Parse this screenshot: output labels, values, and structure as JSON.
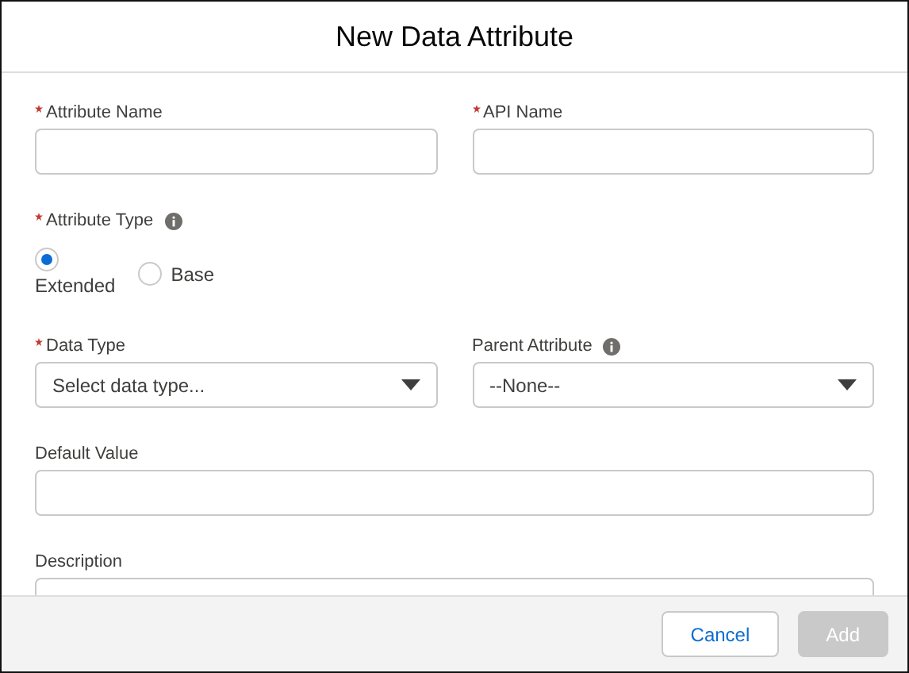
{
  "window": {
    "title": "New Data Attribute"
  },
  "rows": [
    {
      "fields": [
        {
          "kind": "text",
          "label": "Attribute Name",
          "required": true,
          "info": false
        },
        {
          "kind": "text",
          "label": "API Name",
          "required": true,
          "info": false
        }
      ]
    },
    {
      "fields": [
        {
          "kind": "radio",
          "label": "Attribute Type",
          "required": true,
          "info": true,
          "options": [
            {
              "label": "Extended",
              "selected": true
            },
            {
              "label": "Base",
              "selected": false
            }
          ]
        }
      ]
    },
    {
      "fields": [
        {
          "kind": "select",
          "label": "Data Type",
          "required": true,
          "info": false,
          "value": "Select data type..."
        },
        {
          "kind": "select",
          "label": "Parent Attribute",
          "required": false,
          "info": true,
          "value": "--None--"
        }
      ]
    },
    {
      "fields": [
        {
          "kind": "text",
          "label": "Default Value",
          "required": false,
          "info": false
        }
      ]
    },
    {
      "fields": [
        {
          "kind": "textarea",
          "label": "Description",
          "required": false,
          "info": false
        }
      ]
    }
  ],
  "buttons": [
    {
      "label": "Cancel",
      "disabled": false
    },
    {
      "label": "Add",
      "disabled": true
    }
  ]
}
